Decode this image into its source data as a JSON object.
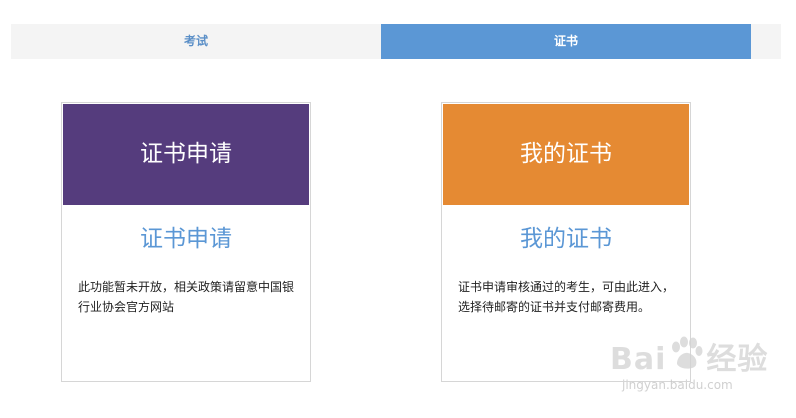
{
  "tabs": {
    "exam": "考试",
    "certificate": "证书"
  },
  "cards": [
    {
      "header": "证书申请",
      "title": "证书申请",
      "description": "此功能暂未开放，相关政策请留意中国银行业协会官方网站",
      "color": "#553c7d"
    },
    {
      "header": "我的证书",
      "title": "我的证书",
      "description": "证书申请审核通过的考生，可由此进入，选择待邮寄的证书并支付邮寄费用。",
      "color": "#e58a33"
    }
  ],
  "watermark": {
    "logo_left": "Bai",
    "logo_right": "经验",
    "site": "jingyan.baidu.com"
  },
  "colors": {
    "active_tab": "#5b97d5",
    "accent_text": "#5b97d5"
  }
}
